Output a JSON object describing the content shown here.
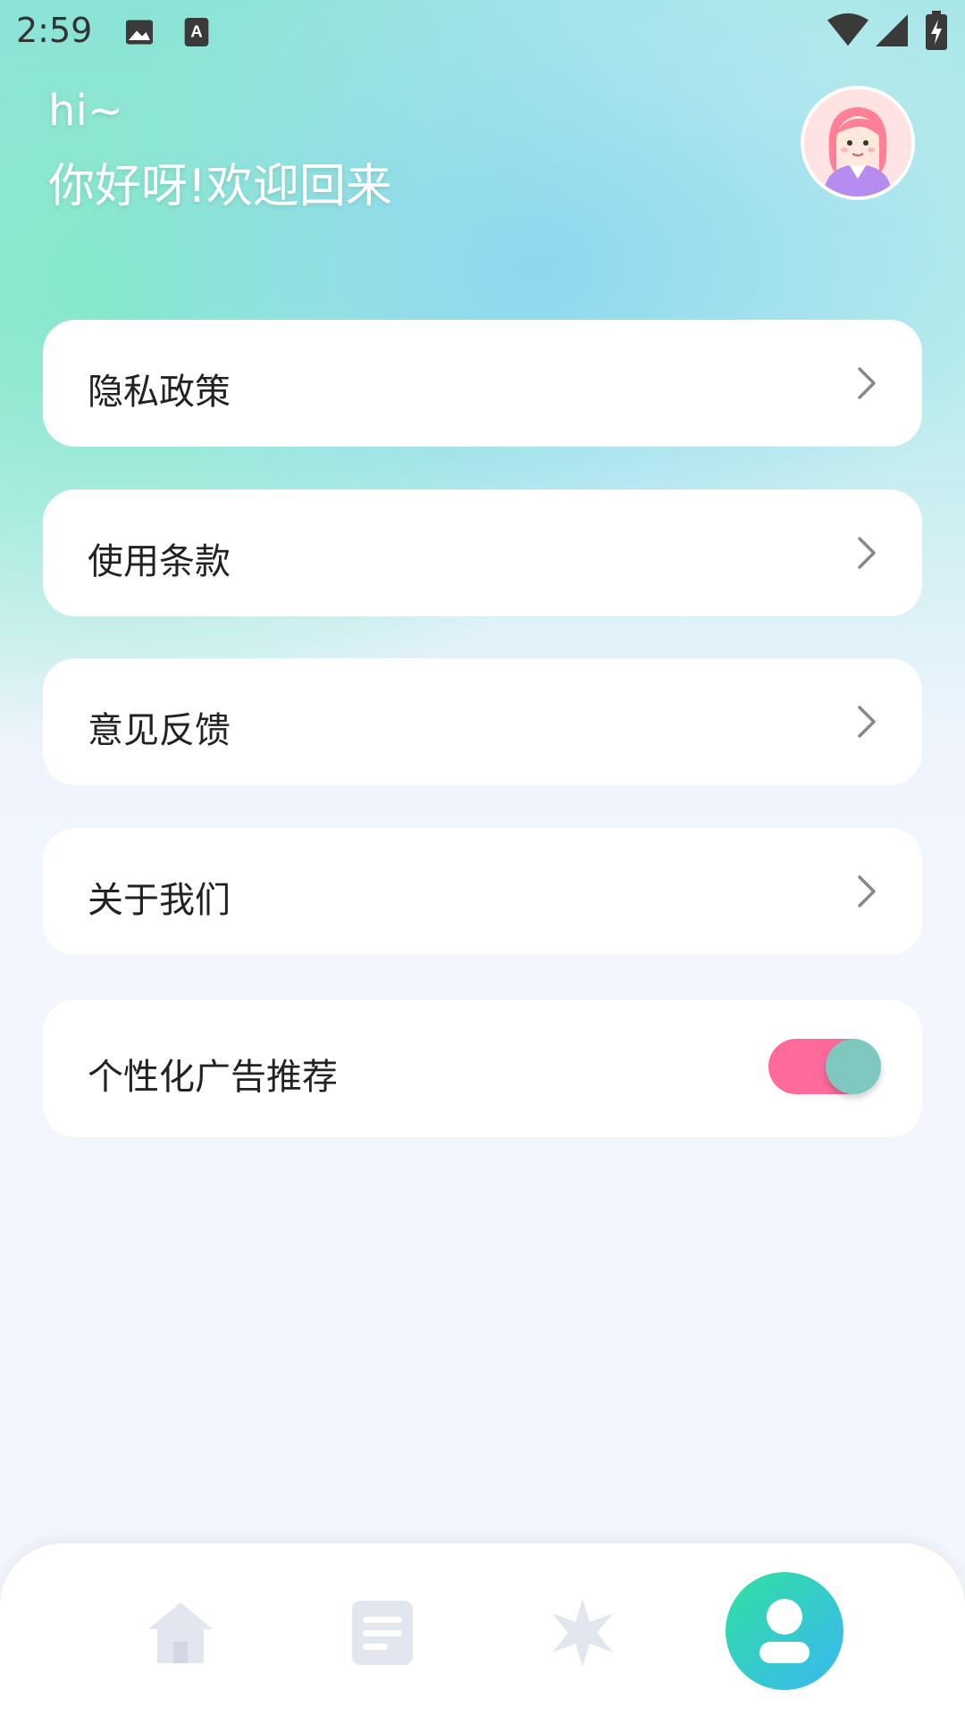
{
  "status_bar": {
    "time": "2:59",
    "icons": [
      "image-icon",
      "keyboard-a-icon",
      "wifi-icon",
      "signal-icon",
      "battery-charging-icon"
    ]
  },
  "header": {
    "greeting": "hi~",
    "welcome": "你好呀!欢迎回来",
    "avatar": "avatar-girl"
  },
  "menu": {
    "items": [
      {
        "label": "隐私政策"
      },
      {
        "label": "使用条款"
      },
      {
        "label": "意见反馈"
      },
      {
        "label": "关于我们"
      }
    ],
    "ad_toggle": {
      "label": "个性化广告推荐",
      "enabled": true
    }
  },
  "nav": {
    "items": [
      "home-icon",
      "list-icon",
      "sparkle-icon",
      "profile-icon"
    ],
    "active": "profile-icon"
  },
  "colors": {
    "accent_pink": "#ff6a9a",
    "nav_gradient_start": "#30e0a0",
    "nav_gradient_end": "#3ab8f2",
    "inactive_icon": "#e2e6ee"
  }
}
